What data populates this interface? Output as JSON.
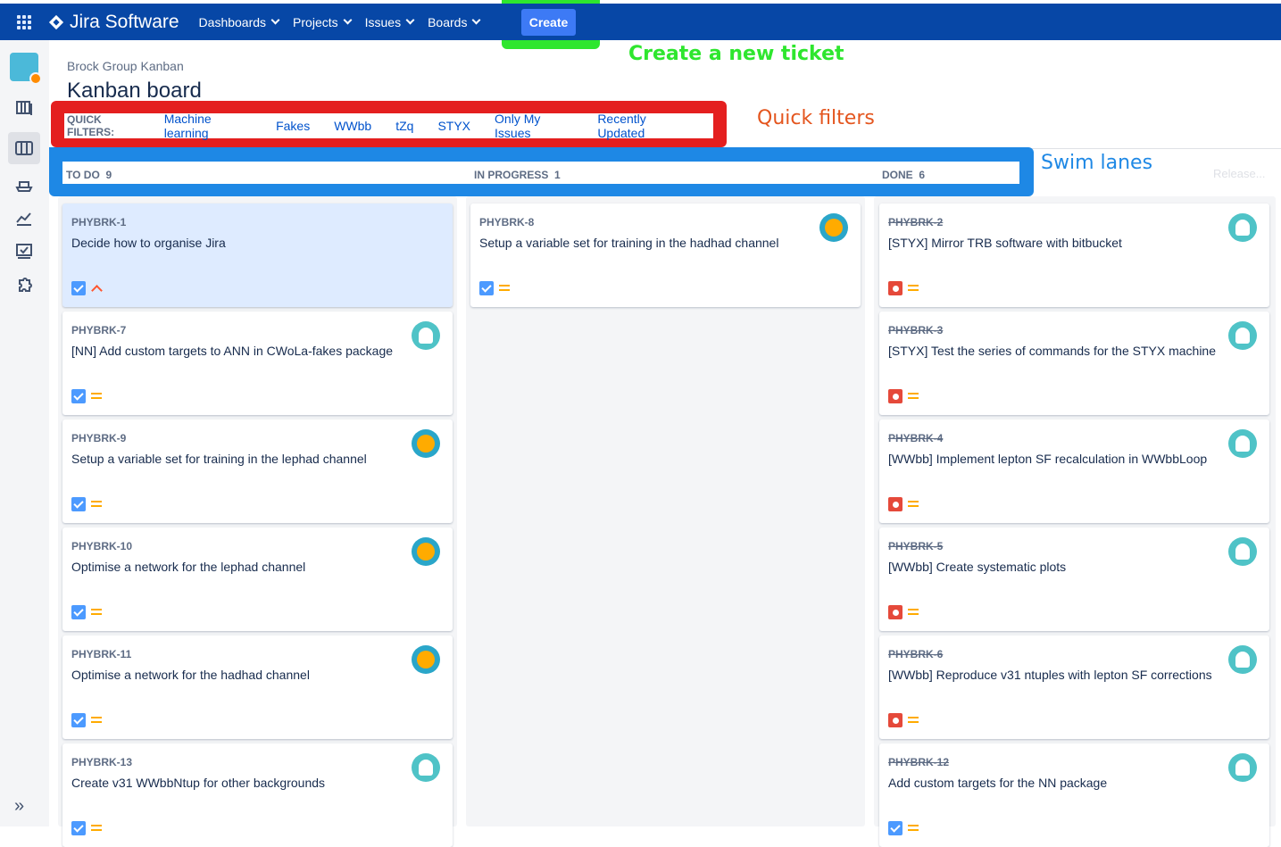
{
  "nav": {
    "brand": "Jira Software",
    "items": [
      {
        "label": "Dashboards"
      },
      {
        "label": "Projects"
      },
      {
        "label": "Issues"
      },
      {
        "label": "Boards"
      }
    ],
    "create_label": "Create"
  },
  "page": {
    "breadcrumb": "Brock Group Kanban",
    "title": "Kanban board"
  },
  "quick_filters": {
    "label": "QUICK FILTERS:",
    "items": [
      "Machine learning",
      "Fakes",
      "WWbb",
      "tZq",
      "STYX",
      "Only My Issues",
      "Recently Updated"
    ]
  },
  "annotations": {
    "create": "Create a new ticket",
    "quick_filters": "Quick filters",
    "swim_lanes": "Swim lanes"
  },
  "release_label": "Release...",
  "columns": [
    {
      "name": "TO DO",
      "count": "9"
    },
    {
      "name": "IN PROGRESS",
      "count": "1"
    },
    {
      "name": "DONE",
      "count": "6"
    }
  ],
  "cards": {
    "todo": [
      {
        "key": "PHYBRK-1",
        "summary": "Decide how to organise Jira",
        "type": "task",
        "priority": "high",
        "avatar": "none"
      },
      {
        "key": "PHYBRK-7",
        "summary": "[NN] Add custom targets to ANN in CWoLa-fakes package",
        "type": "task",
        "priority": "medium",
        "avatar": "ghost"
      },
      {
        "key": "PHYBRK-9",
        "summary": "Setup a variable set for training in the lephad channel",
        "type": "task",
        "priority": "medium",
        "avatar": "owl"
      },
      {
        "key": "PHYBRK-10",
        "summary": "Optimise a network for the lephad channel",
        "type": "task",
        "priority": "medium",
        "avatar": "owl"
      },
      {
        "key": "PHYBRK-11",
        "summary": "Optimise a network for the hadhad channel",
        "type": "task",
        "priority": "medium",
        "avatar": "owl"
      },
      {
        "key": "PHYBRK-13",
        "summary": "Create v31 WWbbNtup for other backgrounds",
        "type": "task",
        "priority": "medium",
        "avatar": "ghost"
      }
    ],
    "inprogress": [
      {
        "key": "PHYBRK-8",
        "summary": "Setup a variable set for training in the hadhad channel",
        "type": "task",
        "priority": "medium",
        "avatar": "owl"
      }
    ],
    "done": [
      {
        "key": "PHYBRK-2",
        "summary": "[STYX] Mirror TRB software with bitbucket",
        "type": "bug",
        "priority": "medium",
        "avatar": "ghost"
      },
      {
        "key": "PHYBRK-3",
        "summary": "[STYX] Test the series of commands for the STYX machine",
        "type": "bug",
        "priority": "medium",
        "avatar": "ghost"
      },
      {
        "key": "PHYBRK-4",
        "summary": "[WWbb] Implement lepton SF recalculation in WWbbLoop",
        "type": "bug",
        "priority": "medium",
        "avatar": "ghost"
      },
      {
        "key": "PHYBRK-5",
        "summary": "[WWbb] Create systematic plots",
        "type": "bug",
        "priority": "medium",
        "avatar": "ghost"
      },
      {
        "key": "PHYBRK-6",
        "summary": "[WWbb] Reproduce v31 ntuples with lepton SF corrections",
        "type": "bug",
        "priority": "medium",
        "avatar": "ghost"
      },
      {
        "key": "PHYBRK-12",
        "summary": "Add custom targets for the NN package",
        "type": "task",
        "priority": "medium",
        "avatar": "ghost"
      }
    ]
  }
}
